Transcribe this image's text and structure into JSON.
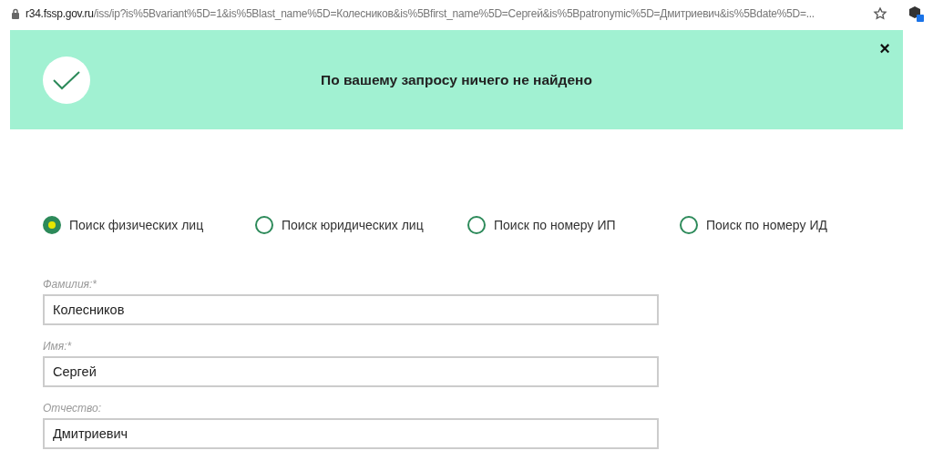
{
  "address_bar": {
    "domain": "r34.fssp.gov.ru",
    "path": "/iss/ip?is%5Bvariant%5D=1&is%5Blast_name%5D=Колесников&is%5Bfirst_name%5D=Сергей&is%5Bpatronymic%5D=Дмитриевич&is%5Bdate%5D=..."
  },
  "alert": {
    "message": "По вашему запросу ничего не найдено",
    "close": "×"
  },
  "search_types": [
    {
      "label": "Поиск физических лиц",
      "selected": true
    },
    {
      "label": "Поиск юридических лиц",
      "selected": false
    },
    {
      "label": "Поиск по номеру ИП",
      "selected": false
    },
    {
      "label": "Поиск по номеру ИД",
      "selected": false
    }
  ],
  "fields": [
    {
      "label": "Фамилия:*",
      "value": "Колесников"
    },
    {
      "label": "Имя:*",
      "value": "Сергей"
    },
    {
      "label": "Отчество:",
      "value": "Дмитриевич"
    }
  ]
}
